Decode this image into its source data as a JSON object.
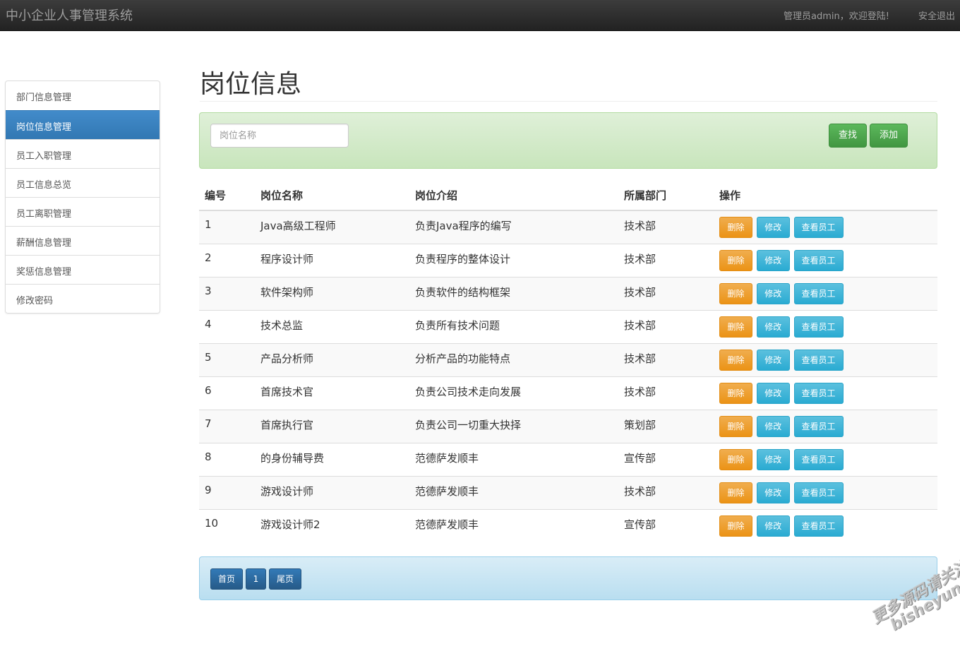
{
  "navbar": {
    "brand": "中小企业人事管理系统",
    "user_greeting": "管理员admin，欢迎登陆!",
    "logout": "安全退出"
  },
  "sidebar": {
    "items": [
      {
        "label": "部门信息管理",
        "active": false
      },
      {
        "label": "岗位信息管理",
        "active": true
      },
      {
        "label": "员工入职管理",
        "active": false
      },
      {
        "label": "员工信息总览",
        "active": false
      },
      {
        "label": "员工离职管理",
        "active": false
      },
      {
        "label": "薪酬信息管理",
        "active": false
      },
      {
        "label": "奖惩信息管理",
        "active": false
      },
      {
        "label": "修改密码",
        "active": false
      }
    ]
  },
  "main": {
    "title": "岗位信息",
    "search": {
      "placeholder": "岗位名称",
      "value": "",
      "find_label": "查找",
      "add_label": "添加"
    },
    "table": {
      "headers": [
        "编号",
        "岗位名称",
        "岗位介绍",
        "所属部门",
        "操作"
      ],
      "rows": [
        {
          "id": "1",
          "name": "Java高级工程师",
          "desc": "负责Java程序的编写",
          "dept": "技术部"
        },
        {
          "id": "2",
          "name": "程序设计师",
          "desc": "负责程序的整体设计",
          "dept": "技术部"
        },
        {
          "id": "3",
          "name": "软件架构师",
          "desc": "负责软件的结构框架",
          "dept": "技术部"
        },
        {
          "id": "4",
          "name": "技术总监",
          "desc": "负责所有技术问题",
          "dept": "技术部"
        },
        {
          "id": "5",
          "name": "产品分析师",
          "desc": "分析产品的功能特点",
          "dept": "技术部"
        },
        {
          "id": "6",
          "name": "首席技术官",
          "desc": "负责公司技术走向发展",
          "dept": "技术部"
        },
        {
          "id": "7",
          "name": "首席执行官",
          "desc": "负责公司一切重大抉择",
          "dept": "策划部"
        },
        {
          "id": "8",
          "name": "的身份辅导费",
          "desc": "范德萨发顺丰",
          "dept": "宣传部"
        },
        {
          "id": "9",
          "name": "游戏设计师",
          "desc": "范德萨发顺丰",
          "dept": "技术部"
        },
        {
          "id": "10",
          "name": "游戏设计师2",
          "desc": "范德萨发顺丰",
          "dept": "宣传部"
        }
      ],
      "actions": {
        "delete": "删除",
        "edit": "修改",
        "view": "查看员工"
      }
    },
    "pagination": {
      "first": "首页",
      "current": "1",
      "last": "尾页"
    }
  },
  "watermark": {
    "line1": "更多源码请关注",
    "line2": "bisheyun.org"
  },
  "colors": {
    "navbar": "#222222",
    "active_item": "#3278b3",
    "success": "#5cb85c",
    "warning": "#f0ad4e",
    "info": "#5bc0de",
    "primary": "#337ab7"
  }
}
